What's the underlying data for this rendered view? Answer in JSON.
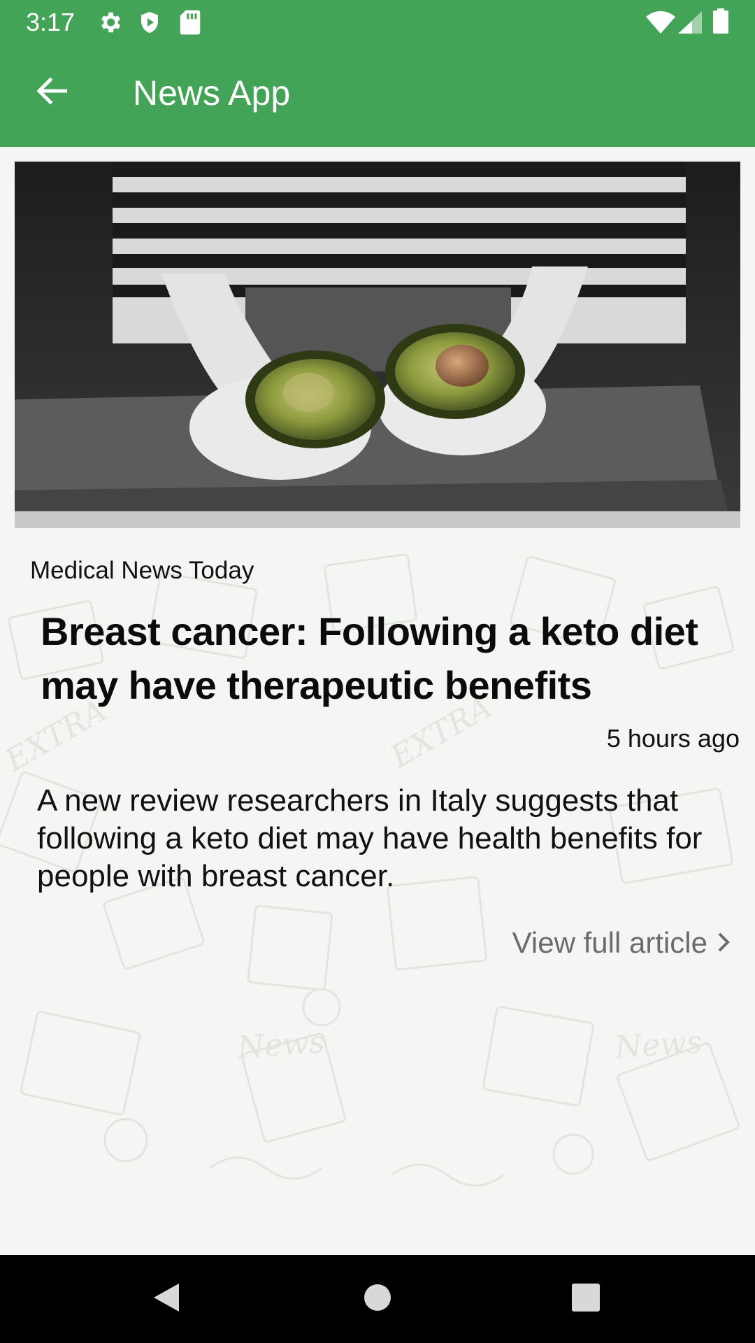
{
  "status_bar": {
    "time": "3:17",
    "left_icons": [
      "gear-icon",
      "shield-icon",
      "sd-card-icon"
    ],
    "right_icons": [
      "wifi-icon",
      "signal-icon",
      "battery-icon"
    ]
  },
  "app_bar": {
    "title": "News App",
    "back_icon": "arrow-left-icon",
    "color": "#43a457"
  },
  "article": {
    "source": "Medical News Today",
    "headline": "Breast cancer: Following a keto diet may have therapeutic benefits",
    "time_ago": "5 hours ago",
    "summary": "A new review researchers in Italy suggests that following a keto diet may have health benefits for people with breast cancer.",
    "view_full_label": "View full article"
  },
  "nav_bar": {
    "buttons": [
      "back-triangle-icon",
      "home-circle-icon",
      "recents-square-icon"
    ]
  }
}
